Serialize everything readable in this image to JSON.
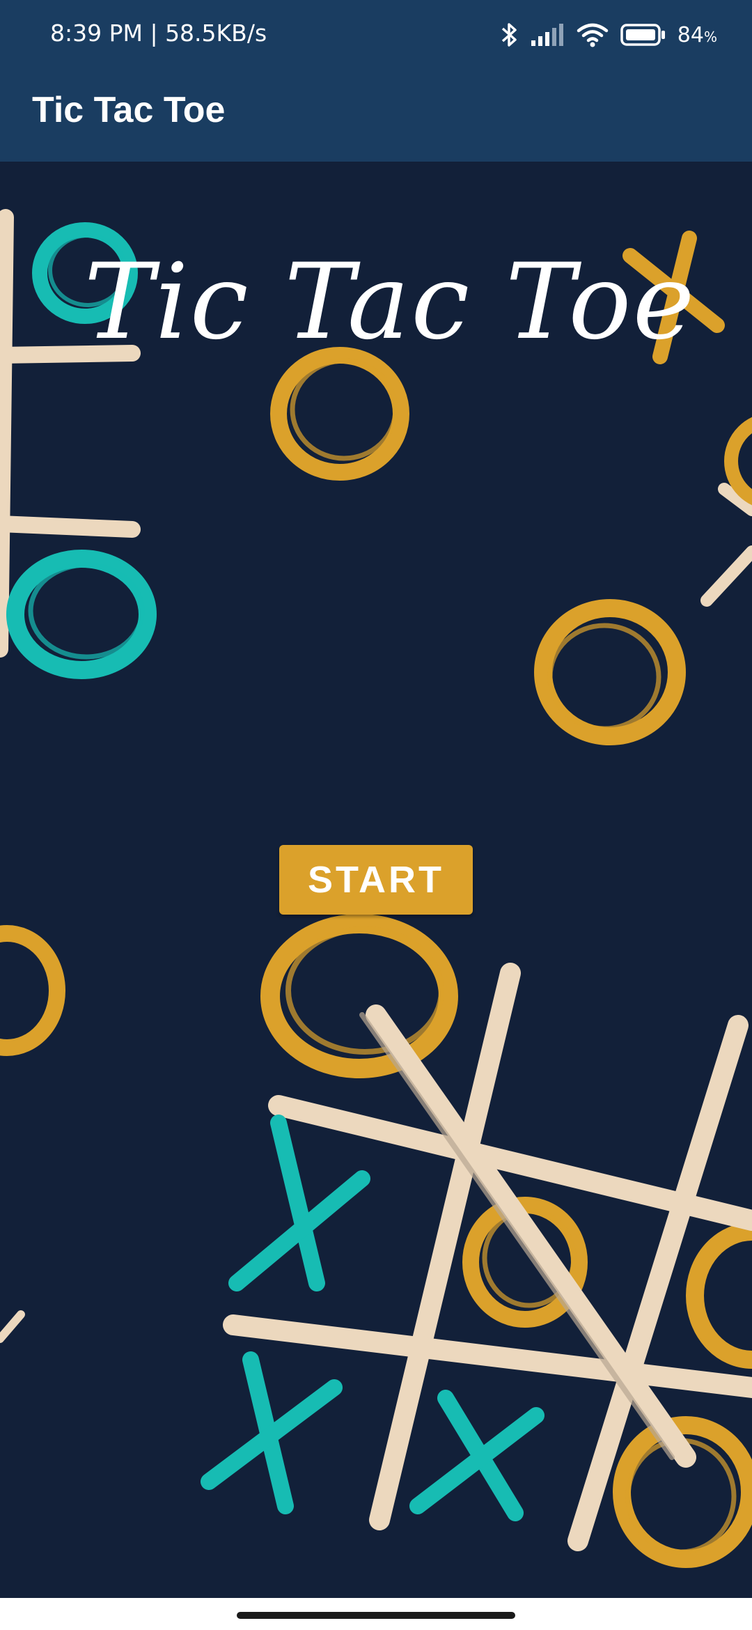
{
  "status_bar": {
    "time_speed": "8:39 PM | 58.5KB/s",
    "battery_percent": "84",
    "battery_unit": "%",
    "icons": [
      "bluetooth-icon",
      "signal-icon",
      "wifi-icon",
      "battery-icon"
    ]
  },
  "app_bar": {
    "title": "Tic Tac Toe",
    "background_color": "#1a3d61"
  },
  "main": {
    "game_title": "Tic Tac Toe",
    "start_label": "START",
    "background_color": "#122039",
    "accent_color": "#dba12b",
    "teal_color": "#17bcb3",
    "cream_color": "#ecd8be"
  },
  "nav_bar": {
    "home_indicator": "home-indicator"
  }
}
